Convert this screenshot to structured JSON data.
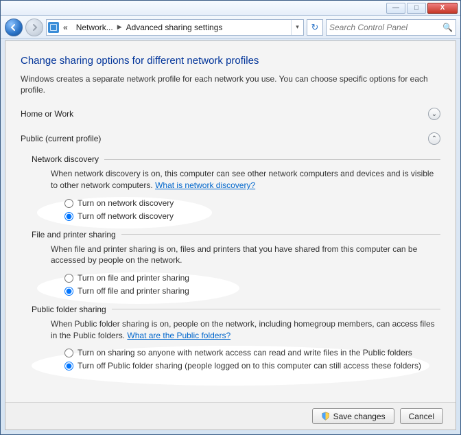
{
  "titlebar": {
    "min": "—",
    "max": "□",
    "close": "X"
  },
  "nav": {
    "path1": "Network...",
    "path2": "Advanced sharing settings",
    "search_placeholder": "Search Control Panel"
  },
  "page": {
    "title": "Change sharing options for different network profiles",
    "intro": "Windows creates a separate network profile for each network you use. You can choose specific options for each profile."
  },
  "profiles": {
    "home": "Home or Work",
    "public": "Public (current profile)"
  },
  "groups": {
    "net": {
      "header": "Network discovery",
      "desc": "When network discovery is on, this computer can see other network computers and devices and is visible to other network computers. ",
      "link": "What is network discovery?",
      "opt_on": "Turn on network discovery",
      "opt_off": "Turn off network discovery"
    },
    "fps": {
      "header": "File and printer sharing",
      "desc": "When file and printer sharing is on, files and printers that you have shared from this computer can be accessed by people on the network.",
      "opt_on": "Turn on file and printer sharing",
      "opt_off": "Turn off file and printer sharing"
    },
    "pub": {
      "header": "Public folder sharing",
      "desc": "When Public folder sharing is on, people on the network, including homegroup members, can access files in the Public folders. ",
      "link": "What are the Public folders?",
      "opt_on": "Turn on sharing so anyone with network access can read and write files in the Public folders",
      "opt_off": "Turn off Public folder sharing (people logged on to this computer can still access these folders)"
    }
  },
  "buttons": {
    "save": "Save changes",
    "cancel": "Cancel"
  }
}
